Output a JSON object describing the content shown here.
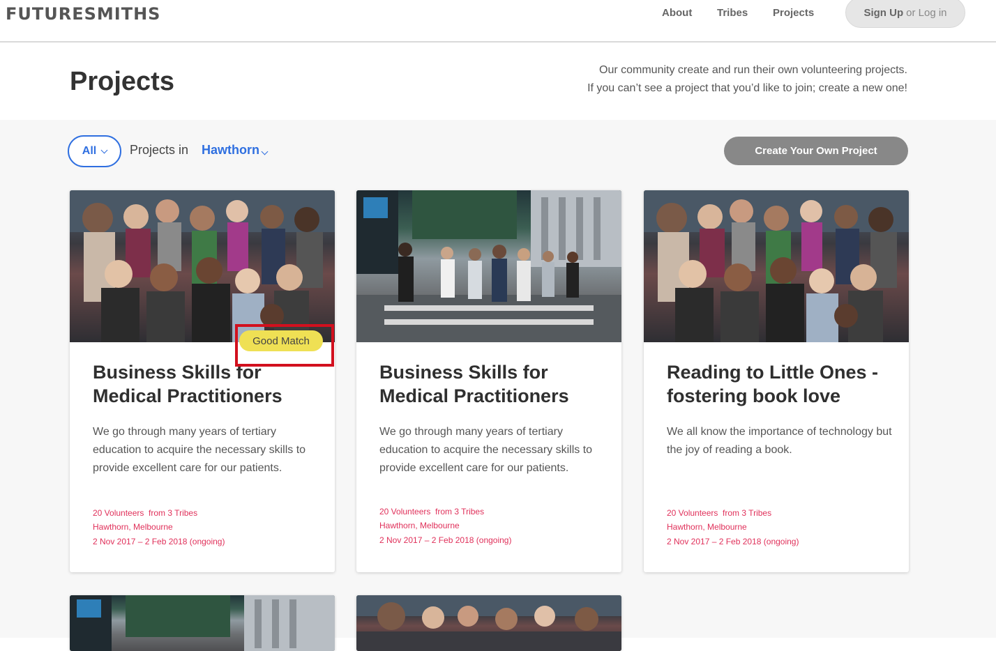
{
  "header": {
    "logo": "FUTURESMITHS",
    "nav": [
      "About",
      "Tribes",
      "Projects"
    ],
    "signup": {
      "primary": "Sign Up",
      "secondary": "or Log in"
    }
  },
  "page": {
    "title": "Projects",
    "intro_line1": "Our community create and run their own volunteering projects.",
    "intro_line2": "If you can’t see a project that you’d like to join; create a new one!"
  },
  "filters": {
    "all_label": "All",
    "projects_in_label": "Projects in",
    "location": "Hawthorn",
    "create_button": "Create Your Own Project"
  },
  "badge": "Good Match",
  "cards": [
    {
      "image": "group-photo",
      "title": "Business Skills for Medical Practitioners",
      "description": "We go through many years of tertiary education to acquire the necessary skills to provide excellent care for our patients.",
      "volunteers": "20 Volunteers  from 3 Tribes",
      "location": "Hawthorn, Melbourne",
      "dates": "2 Nov 2017 – 2 Feb 2018 (ongoing)"
    },
    {
      "image": "street-photo",
      "title": "Business Skills for Medical Practitioners",
      "description": "We go through many years of tertiary education to acquire the necessary skills to provide excellent care for our patients.",
      "volunteers": "20 Volunteers  from 3 Tribes",
      "location": "Hawthorn, Melbourne",
      "dates": "2 Nov 2017 – 2 Feb 2018 (ongoing)"
    },
    {
      "image": "group-photo",
      "title": "Reading to Little Ones - fostering book love",
      "description": "We all know the importance of technology but the joy of reading a book.",
      "volunteers": "20 Volunteers  from 3 Tribes",
      "location": "Hawthorn, Melbourne",
      "dates": "2 Nov 2017 – 2 Feb 2018 (ongoing)"
    }
  ],
  "colors": {
    "accent_blue": "#2f6fe0",
    "meta_pink": "#e0305a",
    "badge_yellow": "#efe054",
    "highlight_red": "#d2101e",
    "button_gray": "#888888"
  }
}
